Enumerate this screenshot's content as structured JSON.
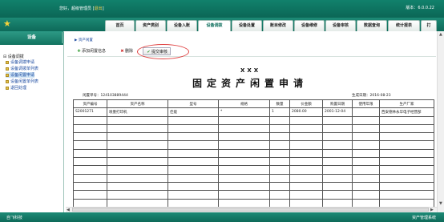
{
  "header": {
    "greeting": "您好，超级管理员 [",
    "logout": "退出",
    "greeting_end": "]",
    "version": "版本：6.0.0.22"
  },
  "nav": {
    "tabs": [
      "首页",
      "资产类别",
      "设备入账",
      "设备调拨",
      "设备处置",
      "账目修改",
      "设备维修",
      "设备审核",
      "数据查询",
      "统计报表",
      "打"
    ],
    "active": "设备调拨"
  },
  "sidebar": {
    "title": "设备",
    "group": "设备调拨",
    "items": [
      "设备调拨申请",
      "设备调拨单列表",
      "设备闲置申请",
      "设备闲置单列表",
      "退回处理"
    ],
    "active_index": 2
  },
  "breadcrumb": "资产闲置",
  "toolbar": {
    "add": "添加闲置信息",
    "delete": "删除",
    "submit": "提交审核"
  },
  "form": {
    "org": "XXX",
    "title": "固定资产闲置申请",
    "doc_no_label": "闲置单号：",
    "doc_no": "124103889444",
    "date_label": "生成日期：",
    "date": "2016-08-23",
    "columns": [
      "资产编号",
      "资产名称",
      "型号",
      "规格",
      "数量",
      "价金额",
      "购置日期",
      "使用年限",
      "生产厂家"
    ],
    "rows": [
      [
        "S2001271",
        "喷墨打印机",
        "佳能",
        "*",
        "1",
        "2080.00",
        "2001-12-04",
        "",
        "西安德林永华电子经营部"
      ]
    ],
    "empty_rows": 11
  },
  "footer": {
    "left": "自飞科技",
    "right": "资产管理系统"
  },
  "colors": {
    "primary": "#11816c",
    "highlight": "#e04444",
    "link": "#1b4aa0"
  },
  "icons": {
    "logo": "star-icon",
    "add": "plus-icon",
    "delete": "delete-icon",
    "submit": "check-icon"
  }
}
